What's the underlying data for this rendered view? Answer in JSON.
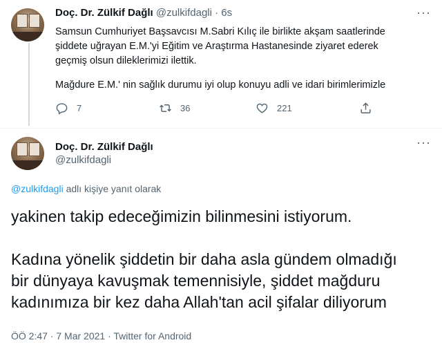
{
  "tweet1": {
    "author_name": "Doç. Dr. Zülkif Dağlı",
    "author_handle": "@zulkifdagli",
    "separator": "·",
    "time": "6s",
    "more": "···",
    "body_lines": [
      "Samsun Cumhuriyet Başsavcısı M.Sabri Kılıç ile birlikte akşam saatlerinde",
      "şiddete uğrayan  E.M.'yi Eğitim ve Araştırma Hastanesinde ziyaret ederek",
      "geçmiş olsun dileklerimizi ilettik.",
      "Mağdure E.M.' nin sağlık durumu iyi olup konuyu adli ve idari birimlerimizle"
    ],
    "actions": {
      "reply_count": "7",
      "retweet_count": "36",
      "like_count": "221"
    }
  },
  "tweet2": {
    "author_name": "Doç. Dr. Zülkif Dağlı",
    "author_handle": "@zulkifdagli",
    "more": "···",
    "reply_handle": "@zulkifdagli",
    "reply_suffix": " adlı kişiye yanıt olarak",
    "body_lines": [
      "yakinen takip edeceğimizin bilinmesini istiyorum.",
      "Kadına yönelik şiddetin bir daha asla gündem olmadığı",
      "bir dünyaya kavuşmak temennisiyle, şiddet mağduru",
      "kadınımıza bir kez daha Allah'tan acil şifalar diliyorum"
    ],
    "meta": "ÖÖ 2:47 · 7 Mar 2021 · Twitter for Android"
  },
  "icons": [
    "reply-icon",
    "retweet-icon",
    "like-icon",
    "share-icon",
    "more-icon"
  ],
  "colors": {
    "link": "#1d9bf0",
    "muted": "#536471",
    "text": "#0f1419",
    "divider": "#eff3f4"
  }
}
